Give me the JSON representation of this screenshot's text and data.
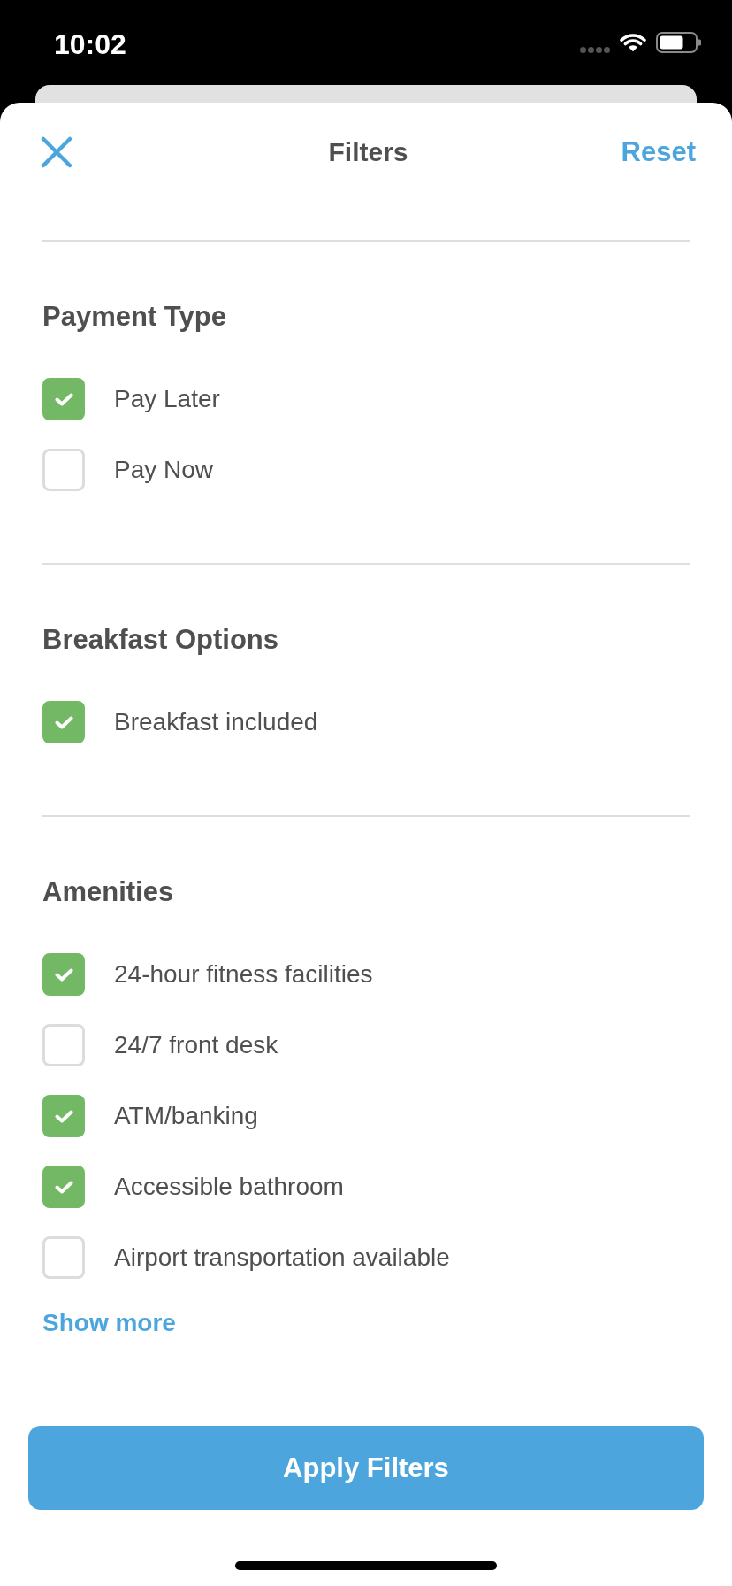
{
  "status_bar": {
    "time": "10:02"
  },
  "header": {
    "title": "Filters",
    "reset_label": "Reset"
  },
  "sections": [
    {
      "title": "Payment Type",
      "options": [
        {
          "label": "Pay Later",
          "checked": true
        },
        {
          "label": "Pay Now",
          "checked": false
        }
      ]
    },
    {
      "title": "Breakfast Options",
      "options": [
        {
          "label": "Breakfast included",
          "checked": true
        }
      ]
    },
    {
      "title": "Amenities",
      "options": [
        {
          "label": "24-hour fitness facilities",
          "checked": true
        },
        {
          "label": "24/7 front desk",
          "checked": false
        },
        {
          "label": "ATM/banking",
          "checked": true
        },
        {
          "label": "Accessible bathroom",
          "checked": true
        },
        {
          "label": "Airport transportation available",
          "checked": false
        }
      ],
      "show_more": "Show more"
    }
  ],
  "apply_button": "Apply Filters"
}
